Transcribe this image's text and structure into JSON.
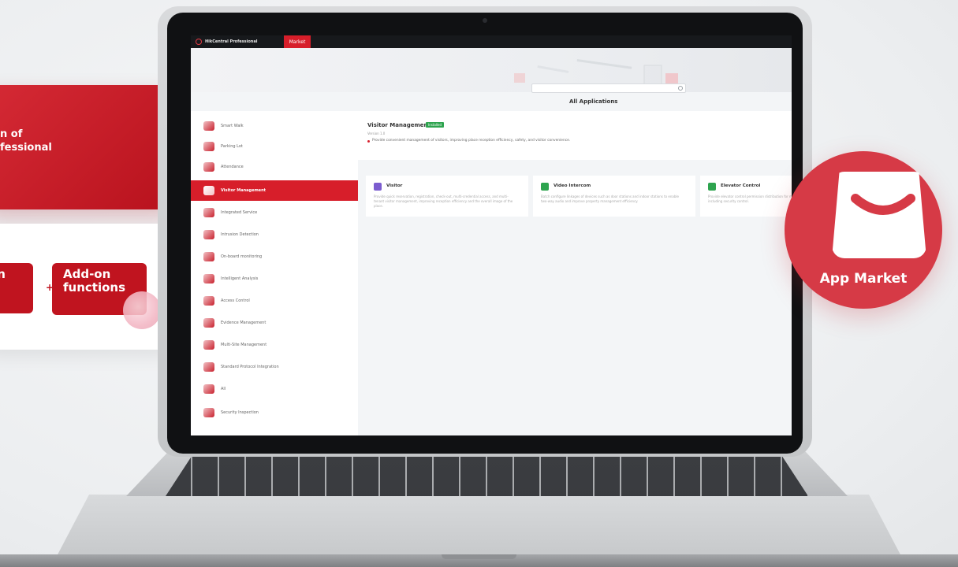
{
  "promo_left": {
    "line1": "n of",
    "line2": "fessional",
    "pill_left": "on",
    "plus": "+",
    "pill_right_line1": "Add-on",
    "pill_right_line2": "functions"
  },
  "app": {
    "title": "HikCentral Professional",
    "market_tab": "Market",
    "section_title": "All Applications",
    "search": {
      "placeholder": ""
    }
  },
  "sidebar": {
    "items": [
      {
        "label": "Smart Walk",
        "active": false
      },
      {
        "label": "Parking Lot",
        "active": false
      },
      {
        "label": "Attendance",
        "active": false
      },
      {
        "label": "Visitor Management",
        "active": true
      },
      {
        "label": "Integrated Service",
        "active": false
      },
      {
        "label": "Intrusion Detection",
        "active": false
      },
      {
        "label": "On-board monitoring",
        "active": false
      },
      {
        "label": "Intelligent Analysis",
        "active": false
      },
      {
        "label": "Access Control",
        "active": false
      },
      {
        "label": "Evidence Management",
        "active": false
      },
      {
        "label": "Multi-Site Management",
        "active": false
      },
      {
        "label": "Standard Protocol Integration",
        "active": false
      },
      {
        "label": "All",
        "active": false
      },
      {
        "label": "Security Inspection",
        "active": false
      }
    ]
  },
  "detail": {
    "title": "Visitor Management",
    "badge": "Installed",
    "version": "Version 1.0",
    "description": "Provide convenient management of visitors, improving place reception efficiency, safety, and visitor convenience."
  },
  "cards": [
    {
      "title": "Visitor",
      "icon_color": "#7b5ccf",
      "description": "Provide quick reservation, registration, check-out, multi-credential access, and multi-tenant visitor management, improving reception efficiency and the overall image of the place."
    },
    {
      "title": "Video Intercom",
      "icon_color": "#2ea44f",
      "description": "Batch configure linkages of devices such as door stations and indoor stations to enable two-way audio and improve property management efficiency."
    },
    {
      "title": "Elevator Control",
      "icon_color": "#2ea44f",
      "description": "Provide elevator control permission distribution for multiple floors, access control including security control."
    }
  ],
  "badge": {
    "label": "App Market",
    "icon": "shopping-bag-icon"
  },
  "colors": {
    "brand_red": "#d71e2a",
    "badge_red": "#d63a46"
  }
}
